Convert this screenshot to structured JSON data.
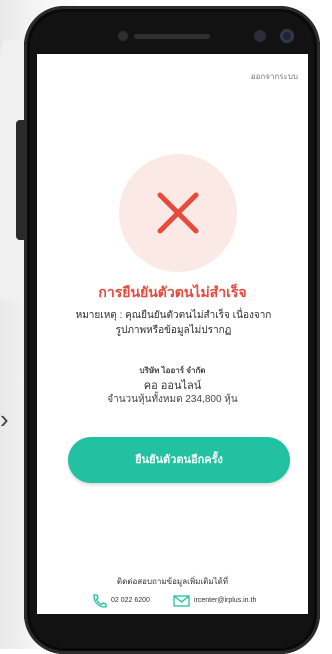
{
  "screen": {
    "logout_label": "ออกจากระบบ",
    "status_icon": "x-icon",
    "title": "การยืนยันตัวตนไม่สำเร็จ",
    "note_line1": "หมายเหตุ : คุณยืนยันตัวตนไม่สำเร็จ เนื่องจาก",
    "note_line2": "รูปภาพหรือข้อมูลไม่ปรากฏ",
    "company_name": "บริษัท ไออาร์ จำกัด",
    "holder_name": "คอ ออนไลน์",
    "shares_text": "จำนวนหุ้นทั้งหมด 234,800 หุ้น",
    "retry_button": "ยืนยันตัวตนอีกครั้ง",
    "contact_label": "ติดต่อสอบถามข้อมูลเพิ่มเติมได้ที่",
    "phone_number": "02 022 6200",
    "email": "ircenter@irplus.in.th"
  },
  "colors": {
    "accent_green": "#21c1a1",
    "error_red": "#e84a3c",
    "error_bg": "#fbe9e5"
  }
}
